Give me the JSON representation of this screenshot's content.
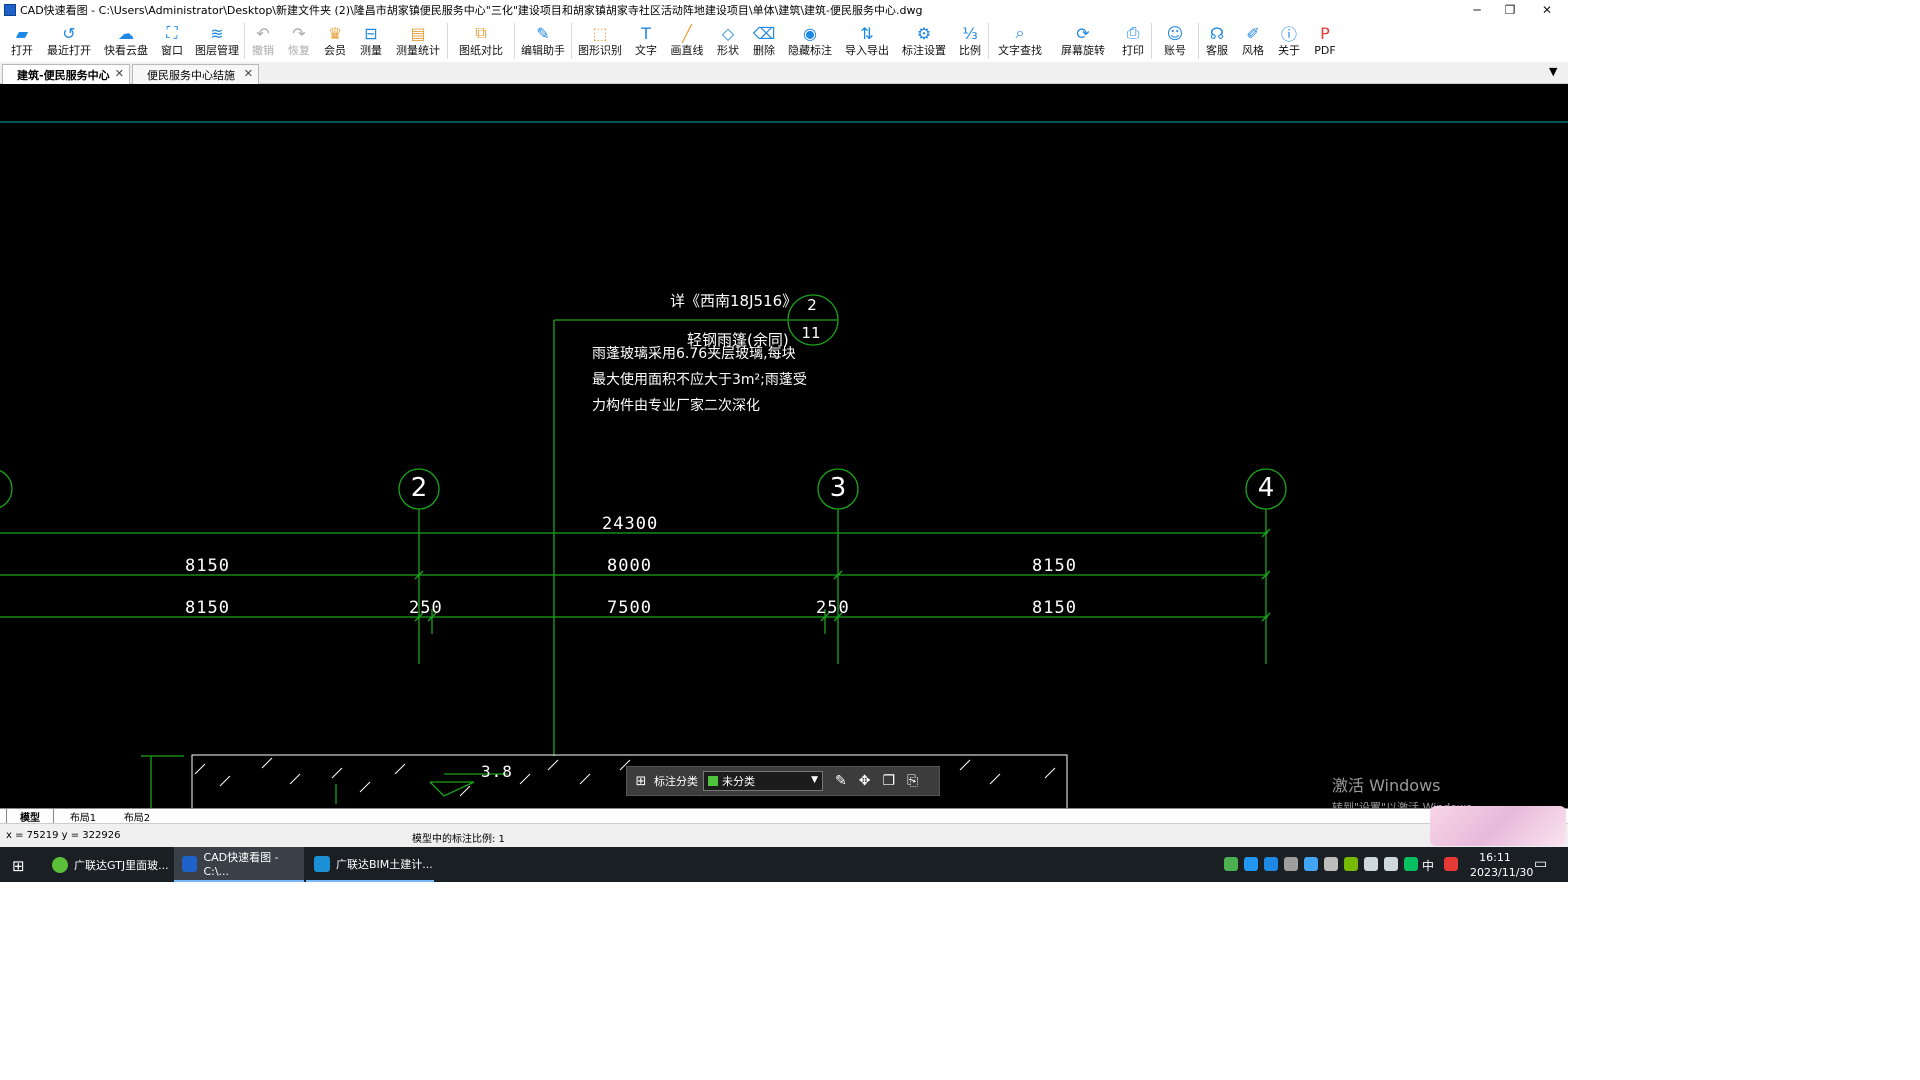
{
  "window": {
    "title": "CAD快速看图 - C:\\Users\\Administrator\\Desktop\\新建文件夹 (2)\\隆昌市胡家镇便民服务中心\"三化\"建设项目和胡家镇胡家寺社区活动阵地建设项目\\单体\\建筑\\建筑-便民服务中心.dwg",
    "minimize": "─",
    "restore": "❐",
    "close": "✕"
  },
  "toolbar": [
    {
      "label": "打开",
      "icon": "folder-icon",
      "color": "#1e88e5"
    },
    {
      "label": "最近打开",
      "icon": "history-icon",
      "color": "#1e88e5"
    },
    {
      "label": "快看云盘",
      "icon": "cloud-icon",
      "color": "#1e88e5"
    },
    {
      "label": "窗口",
      "icon": "window-icon",
      "color": "#1e88e5"
    },
    {
      "label": "图层管理",
      "icon": "layers-icon",
      "color": "#1e88e5"
    },
    {
      "label": "撤销",
      "icon": "undo-icon",
      "color": "#aaaaaa",
      "disabled": true
    },
    {
      "label": "恢复",
      "icon": "redo-icon",
      "color": "#aaaaaa",
      "disabled": true
    },
    {
      "label": "会员",
      "icon": "vip-icon",
      "color": "#e6a23c"
    },
    {
      "label": "测量",
      "icon": "measure-icon",
      "color": "#1e88e5"
    },
    {
      "label": "测量统计",
      "icon": "measure-stats-icon",
      "color": "#e6a23c"
    },
    {
      "label": "图纸对比",
      "icon": "compare-icon",
      "color": "#e6a23c"
    },
    {
      "label": "编辑助手",
      "icon": "edit-assistant-icon",
      "color": "#1e88e5"
    },
    {
      "label": "图形识别",
      "icon": "shape-recognize-icon",
      "color": "#e6a23c"
    },
    {
      "label": "文字",
      "icon": "text-icon",
      "color": "#1e88e5"
    },
    {
      "label": "画直线",
      "icon": "line-icon",
      "color": "#e6a23c"
    },
    {
      "label": "形状",
      "icon": "shape-icon",
      "color": "#1e88e5"
    },
    {
      "label": "删除",
      "icon": "eraser-icon",
      "color": "#1e88e5"
    },
    {
      "label": "隐藏标注",
      "icon": "hide-annotation-icon",
      "color": "#1e88e5"
    },
    {
      "label": "导入导出",
      "icon": "import-export-icon",
      "color": "#1e88e5"
    },
    {
      "label": "标注设置",
      "icon": "annotation-settings-icon",
      "color": "#1e88e5"
    },
    {
      "label": "比例",
      "icon": "scale-icon",
      "color": "#1e88e5"
    },
    {
      "label": "文字查找",
      "icon": "text-search-icon",
      "color": "#1e88e5"
    },
    {
      "label": "屏幕旋转",
      "icon": "rotate-screen-icon",
      "color": "#1e88e5"
    },
    {
      "label": "打印",
      "icon": "print-icon",
      "color": "#1e88e5"
    },
    {
      "label": "账号",
      "icon": "account-icon",
      "color": "#1e88e5"
    },
    {
      "label": "客服",
      "icon": "headset-icon",
      "color": "#1e88e5"
    },
    {
      "label": "风格",
      "icon": "style-icon",
      "color": "#1e88e5"
    },
    {
      "label": "关于",
      "icon": "info-icon",
      "color": "#1e88e5"
    },
    {
      "label": "PDF",
      "icon": "pdf-icon",
      "color": "#e53935"
    }
  ],
  "tabs": [
    {
      "label": "建筑-便民服务中心",
      "active": true,
      "close": "✕"
    },
    {
      "label": "便民服务中心结施",
      "active": false,
      "close": "✕"
    }
  ],
  "tab_menu_icon": "▼",
  "drawing": {
    "ref_text": "详《西南18J516》",
    "detail_top": "2",
    "detail_bottom": "11",
    "canopy_label": "轻钢雨篷(余同)",
    "note_lines": [
      "雨蓬玻璃采用6.76夹层玻璃,每块",
      "最大使用面积不应大于3m²;雨蓬受",
      "力构件由专业厂家二次深化"
    ],
    "axes": [
      "2",
      "3",
      "4"
    ],
    "total_dim": "24300",
    "dims_row1": [
      "8150",
      "8000",
      "8150"
    ],
    "dims_row2": [
      "8150",
      "250",
      "7500",
      "250",
      "8150"
    ],
    "elevation": "3.8",
    "line_color": "#1aa51a",
    "guide_color": "#00a8b0"
  },
  "float_bar": {
    "label": "标注分类",
    "select_value": "未分类",
    "accent": "#4fc13e"
  },
  "watermark": {
    "line1": "激活 Windows",
    "line2": "转到\"设置\"以激活 Windows。"
  },
  "layout_tabs": [
    "模型",
    "布局1",
    "布局2"
  ],
  "status": {
    "coords": "x = 75219  y = 322926",
    "scale": "模型中的标注比例: 1"
  },
  "taskbar": {
    "items": [
      {
        "label": "广联达GTJ里面玻...",
        "color": "#5bbf3a"
      },
      {
        "label": "CAD快速看图 - C:\\...",
        "color": "#1e62c8"
      },
      {
        "label": "广联达BIM土建计...",
        "color": "#1a8fd6"
      }
    ],
    "ime": "中",
    "time": "16:11",
    "date": "2023/11/30"
  }
}
